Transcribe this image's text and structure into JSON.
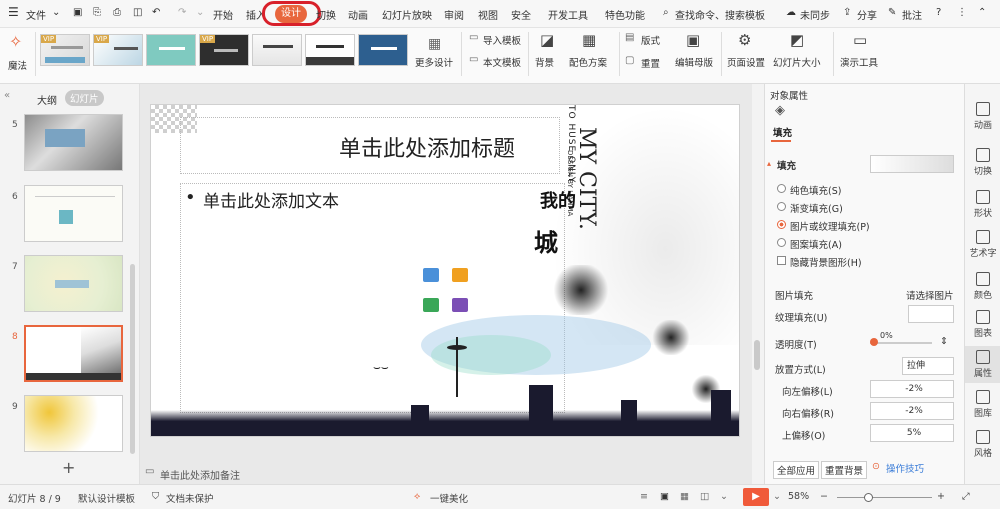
{
  "menubar": {
    "file": "文件",
    "tabs": [
      "开始",
      "插入",
      "设计",
      "切换",
      "动画",
      "幻灯片放映",
      "审阅",
      "视图",
      "安全",
      "开发工具",
      "特色功能"
    ],
    "active_tab": "设计",
    "search": "查找命令、搜索模板",
    "sync": "未同步",
    "share": "分享",
    "comment": "批注"
  },
  "ribbon": {
    "magic": "魔法",
    "vip": "VIP",
    "more_designs": "更多设计",
    "import_template": "导入模板",
    "this_template": "本文模板",
    "background": "背景",
    "color_scheme": "配色方案",
    "layout": "版式",
    "reset": "重置",
    "edit_master": "编辑母版",
    "page_setup": "页面设置",
    "slide_size": "幻灯片大小",
    "presenter_tools": "演示工具"
  },
  "left_pane": {
    "tab_outline": "大纲",
    "tab_slides": "幻灯片",
    "slide_numbers": [
      "5",
      "6",
      "7",
      "8",
      "9"
    ],
    "add": "+"
  },
  "slide": {
    "title": "单击此处添加标题",
    "body": "单击此处添加文本",
    "logo_en": "MY CITY.",
    "logo_sub": "DESIGN BY HANMA",
    "logo_side": "TO HUSE ONLY",
    "logo_cn_1": "我的",
    "logo_cn_2": "城"
  },
  "notes": "单击此处添加备注",
  "right_panel": {
    "title": "对象属性",
    "tab_fill": "填充",
    "section_fill": "填充",
    "options": [
      "纯色填充(S)",
      "渐变填充(G)",
      "图片或纹理填充(P)",
      "图案填充(A)"
    ],
    "selected_option": 2,
    "hide_bg": "隐藏背景图形(H)",
    "picture_fill_label": "图片填充",
    "picture_fill_value": "请选择图片",
    "texture_fill_label": "纹理填充(U)",
    "transparency_label": "透明度(T)",
    "transparency_value": "0%",
    "transparency_fraction": 0,
    "placement_label": "放置方式(L)",
    "placement_value": "拉伸",
    "offset_left_label": "向左偏移(L)",
    "offset_left_value": "-2%",
    "offset_right_label": "向右偏移(R)",
    "offset_right_value": "-2%",
    "offset_top_label": "上偏移(O)",
    "offset_top_value": "5%",
    "apply_all": "全部应用",
    "reset_bg": "重置背景",
    "tips": "操作技巧"
  },
  "right_strip": [
    "动画",
    "切换",
    "形状",
    "艺术字",
    "颜色",
    "图表",
    "属性",
    "图库",
    "风格"
  ],
  "statusbar": {
    "slide_pos": "幻灯片 8 / 9",
    "template": "默认设计模板",
    "protect": "文档未保护",
    "beautify": "一键美化",
    "zoom": "58%"
  },
  "colors": {
    "accent": "#e8663d",
    "highlight_ring": "#d8202a",
    "selected_slide_border": "#e8663d",
    "play_button": "#f05a3a"
  }
}
